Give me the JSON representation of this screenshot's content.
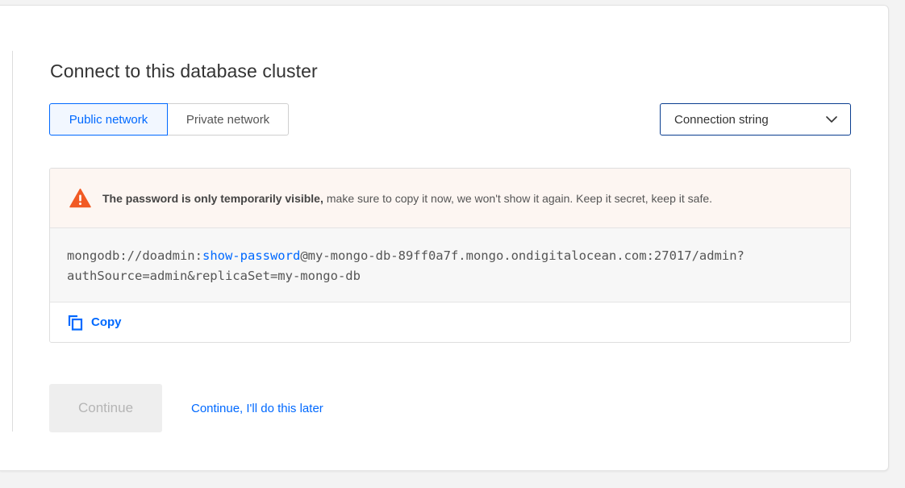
{
  "page": {
    "title": "Connect to this database cluster"
  },
  "network": {
    "tabs": [
      {
        "label": "Public network",
        "selected": true
      },
      {
        "label": "Private network",
        "selected": false
      }
    ]
  },
  "format_select": {
    "value": "Connection string"
  },
  "warning": {
    "bold": "The password is only temporarily visible,",
    "text": "make sure to copy it now, we won't show it again. Keep it secret, keep it safe."
  },
  "connection": {
    "prefix": "mongodb://doadmin:",
    "password_link": "show-password",
    "host": "@my-mongo-db-89ff0a7f.mongo.ondigitalocean.com:27017/admin?",
    "params": "authSource=admin&replicaSet=my-mongo-db"
  },
  "copy": {
    "label": "Copy"
  },
  "actions": {
    "continue_label": "Continue",
    "continue_disabled": true,
    "later_label": "Continue, I'll do this later"
  },
  "colors": {
    "accent": "#0069ff",
    "warning_icon": "#f15a24",
    "warning_bg": "#fdf6f2",
    "select_border": "#0a3d8f"
  },
  "icons": {
    "warning": "warning-triangle-icon",
    "dropdown": "chevron-down-icon",
    "copy": "copy-icon"
  }
}
